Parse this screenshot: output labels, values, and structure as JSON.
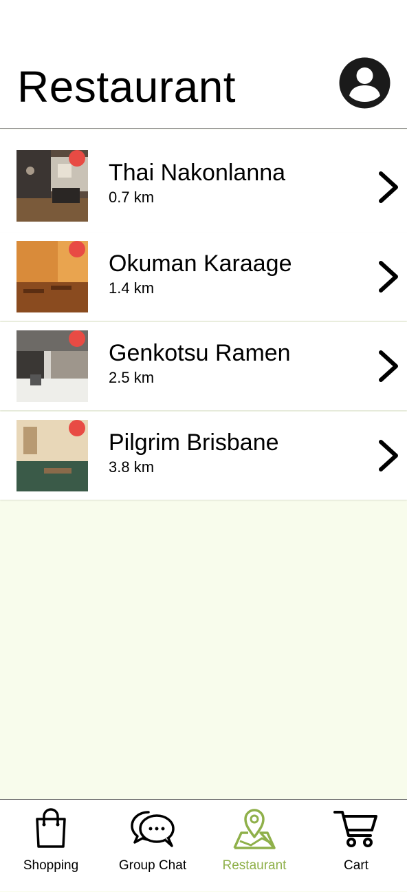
{
  "header": {
    "title": "Restaurant",
    "profile_icon": "user-circle-icon"
  },
  "restaurants": [
    {
      "name": "Thai Nakonlanna",
      "distance": "0.7 km"
    },
    {
      "name": "Okuman Karaage",
      "distance": "1.4 km"
    },
    {
      "name": "Genkotsu Ramen",
      "distance": "2.5 km"
    },
    {
      "name": "Pilgrim Brisbane",
      "distance": "3.8 km"
    }
  ],
  "tabs": [
    {
      "label": "Shopping",
      "icon": "shopping-bag-icon",
      "active": false
    },
    {
      "label": "Group Chat",
      "icon": "chat-bubbles-icon",
      "active": false
    },
    {
      "label": "Restaurant",
      "icon": "map-pin-icon",
      "active": true
    },
    {
      "label": "Cart",
      "icon": "cart-icon",
      "active": false
    }
  ],
  "colors": {
    "accent": "#8fb04a",
    "badge": "#e84b44",
    "content_background": "#f8fcec"
  }
}
